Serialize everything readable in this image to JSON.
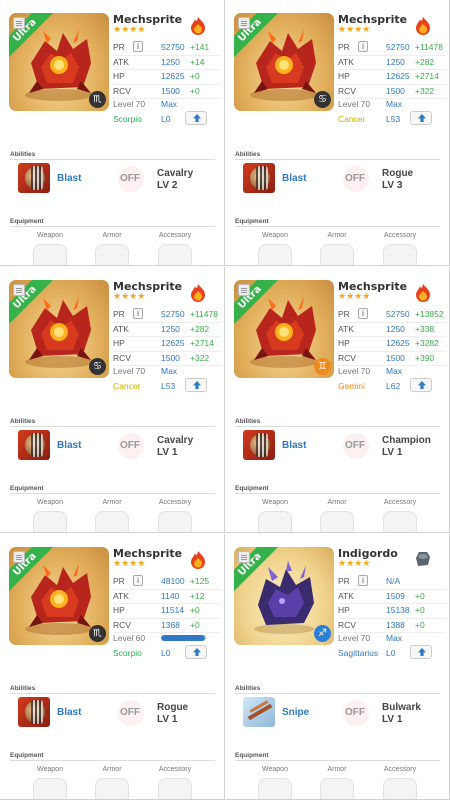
{
  "labels": {
    "abilities": "Abilities",
    "equipment": "Equipment",
    "weapon": "Weapon",
    "armor": "Armor",
    "accessory": "Accessory",
    "off": "OFF",
    "pr": "PR",
    "atk": "ATK",
    "hp": "HP",
    "rcv": "RCV",
    "ribbon": "Ultra",
    "info": "i"
  },
  "colors": {
    "stat_value": "#2f79c6",
    "stat_bonus": "#3cab4a",
    "ribbon": "#35b24a",
    "stars": "#f5a623",
    "scorpio": "#2dad5a",
    "cancer": "#c9b100",
    "gemini": "#ee8a1c",
    "sagittarius": "#2f79c6"
  },
  "cards": [
    {
      "name": "Mechsprite",
      "stars": "★★★★",
      "element_icon": "fire-icon",
      "pr": "52750",
      "pr_bonus": "+141",
      "atk": "1250",
      "atk_bonus": "+14",
      "hp": "12625",
      "hp_bonus": "+0",
      "rcv": "1500",
      "rcv_bonus": "+0",
      "level": "Level 70",
      "level_status": "Max",
      "level_progress": null,
      "sign": "Scorpio",
      "sign_color": "#2dad5a",
      "sign_glyph": "♏",
      "sign_key": "scorpio",
      "lpoints": "L0",
      "ability": "Blast",
      "ability_icon": "blast-icon",
      "class_name": "Cavalry",
      "class_lv": "LV 2"
    },
    {
      "name": "Mechsprite",
      "stars": "★★★★",
      "element_icon": "fire-icon",
      "pr": "52750",
      "pr_bonus": "+11478",
      "atk": "1250",
      "atk_bonus": "+282",
      "hp": "12625",
      "hp_bonus": "+2714",
      "rcv": "1500",
      "rcv_bonus": "+322",
      "level": "Level 70",
      "level_status": "Max",
      "level_progress": null,
      "sign": "Cancer",
      "sign_color": "#c9b100",
      "sign_glyph": "♋",
      "sign_key": "cancer",
      "lpoints": "L53",
      "ability": "Blast",
      "ability_icon": "blast-icon",
      "class_name": "Rogue",
      "class_lv": "LV 3"
    },
    {
      "name": "Mechsprite",
      "stars": "★★★★",
      "element_icon": "fire-icon",
      "pr": "52750",
      "pr_bonus": "+11478",
      "atk": "1250",
      "atk_bonus": "+282",
      "hp": "12625",
      "hp_bonus": "+2714",
      "rcv": "1500",
      "rcv_bonus": "+322",
      "level": "Level 70",
      "level_status": "Max",
      "level_progress": null,
      "sign": "Cancer",
      "sign_color": "#c9b100",
      "sign_glyph": "♋",
      "sign_key": "cancer",
      "lpoints": "L53",
      "ability": "Blast",
      "ability_icon": "blast-icon",
      "class_name": "Cavalry",
      "class_lv": "LV 1"
    },
    {
      "name": "Mechsprite",
      "stars": "★★★★",
      "element_icon": "fire-icon",
      "pr": "52750",
      "pr_bonus": "+13852",
      "atk": "1250",
      "atk_bonus": "+338",
      "hp": "12625",
      "hp_bonus": "+3282",
      "rcv": "1500",
      "rcv_bonus": "+390",
      "level": "Level 70",
      "level_status": "Max",
      "level_progress": null,
      "sign": "Gemini",
      "sign_color": "#ee8a1c",
      "sign_glyph": "♊",
      "sign_key": "gemini",
      "lpoints": "L62",
      "ability": "Blast",
      "ability_icon": "blast-icon",
      "class_name": "Champion",
      "class_lv": "LV 1"
    },
    {
      "name": "Mechsprite",
      "stars": "★★★★",
      "element_icon": "fire-icon",
      "pr": "48100",
      "pr_bonus": "+125",
      "atk": "1140",
      "atk_bonus": "+12",
      "hp": "11514",
      "hp_bonus": "+0",
      "rcv": "1368",
      "rcv_bonus": "+0",
      "level": "Level 60",
      "level_status": "",
      "level_progress": 0.95,
      "sign": "Scorpio",
      "sign_color": "#2dad5a",
      "sign_glyph": "♏",
      "sign_key": "scorpio",
      "lpoints": "L0",
      "ability": "Blast",
      "ability_icon": "blast-icon",
      "class_name": "Rogue",
      "class_lv": "LV 1"
    },
    {
      "name": "Indigordo",
      "stars": "★★★★",
      "element_icon": "stone-icon",
      "pr": "N/A",
      "pr_bonus": "",
      "atk": "1509",
      "atk_bonus": "+0",
      "hp": "15138",
      "hp_bonus": "+0",
      "rcv": "1388",
      "rcv_bonus": "+0",
      "level": "Level 70",
      "level_status": "Max",
      "level_progress": null,
      "sign": "Sagittarius",
      "sign_color": "#2f79c6",
      "sign_glyph": "♐",
      "sign_key": "sag",
      "lpoints": "L0",
      "ability": "Snipe",
      "ability_icon": "snipe-icon",
      "class_name": "Bulwark",
      "class_lv": "LV 1"
    }
  ]
}
